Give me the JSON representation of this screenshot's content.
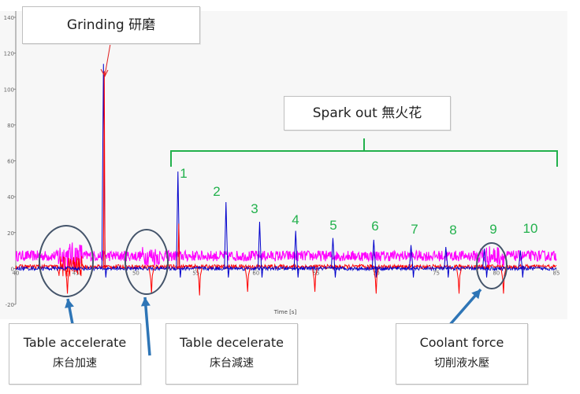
{
  "annotations": {
    "grinding": "Grinding   研磨",
    "spark_out": "Spark out  無火花",
    "table_accelerate": {
      "line1": "Table accelerate",
      "line2": "床台加速"
    },
    "table_decelerate": {
      "line1": "Table decelerate",
      "line2": "床台減速"
    },
    "coolant_force": {
      "line1": "Coolant force",
      "line2": "切削液水壓"
    },
    "spark_numbers": [
      "1",
      "2",
      "3",
      "4",
      "5",
      "6",
      "7",
      "8",
      "9",
      "10"
    ]
  },
  "colors": {
    "magenta": "#ff00ff",
    "red": "#ff0000",
    "blue": "#0000cc",
    "green_annotation": "#22b14c",
    "callout_blue": "#2e75b6",
    "circle": "#44546a"
  },
  "chart_data": {
    "type": "line",
    "xlabel": "Time [s]",
    "ylabel": "",
    "xlim": [
      40,
      85
    ],
    "ylim": [
      -20,
      140
    ],
    "x_ticks": [
      "40",
      "45",
      "50",
      "55",
      "60",
      "65",
      "70",
      "75",
      "80",
      "85"
    ],
    "y_ticks": [
      "-20",
      "0",
      "20",
      "40",
      "60",
      "80",
      "100",
      "120",
      "140"
    ],
    "grid": false,
    "series": [
      {
        "color": "#ff00ff",
        "description_values": {
          "baseline": 7,
          "noise": 3
        }
      },
      {
        "color": "#0000cc",
        "peaks": [
          {
            "x": 47.3,
            "y": 114
          },
          {
            "x": 53.5,
            "y": 54
          },
          {
            "x": 57.5,
            "y": 37
          },
          {
            "x": 60.3,
            "y": 26
          },
          {
            "x": 63.3,
            "y": 21
          },
          {
            "x": 66.4,
            "y": 17
          },
          {
            "x": 69.8,
            "y": 16
          },
          {
            "x": 72.9,
            "y": 13
          },
          {
            "x": 75.8,
            "y": 12
          },
          {
            "x": 79,
            "y": 11
          },
          {
            "x": 82,
            "y": 10
          }
        ]
      },
      {
        "color": "#ff0000",
        "peaks": [
          {
            "x": 47.3,
            "y": 110
          },
          {
            "x": 53.5,
            "y": 25
          }
        ],
        "dips": [
          {
            "x": 44.3,
            "y": -14
          },
          {
            "x": 51.3,
            "y": -14
          },
          {
            "x": 55.3,
            "y": -15
          },
          {
            "x": 59.3,
            "y": -13
          },
          {
            "x": 64.9,
            "y": -13
          },
          {
            "x": 70.0,
            "y": -14
          },
          {
            "x": 76.9,
            "y": -14
          },
          {
            "x": 80.6,
            "y": -14
          }
        ]
      }
    ]
  }
}
